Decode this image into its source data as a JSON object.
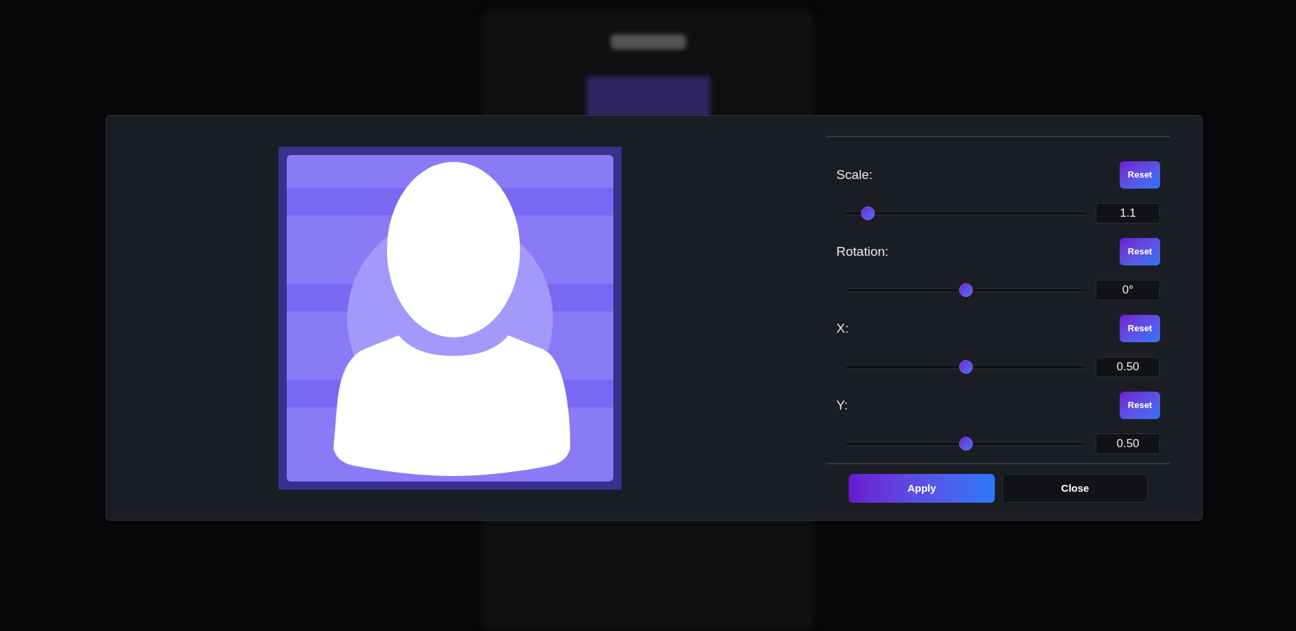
{
  "image_editor": {
    "controls": [
      {
        "label": "Scale:",
        "reset": "Reset",
        "level": 0.09,
        "value": "1.1"
      },
      {
        "label": "Rotation:",
        "reset": "Reset",
        "level": 0.5,
        "value": "0°"
      },
      {
        "label": "X:",
        "reset": "Reset",
        "level": 0.5,
        "value": "0.50"
      },
      {
        "label": "Y:",
        "reset": "Reset",
        "level": 0.5,
        "value": "0.50"
      }
    ],
    "buttons": [
      {
        "label": "Apply",
        "kind": "primary"
      },
      {
        "label": "Close",
        "kind": "secondary"
      }
    ]
  }
}
